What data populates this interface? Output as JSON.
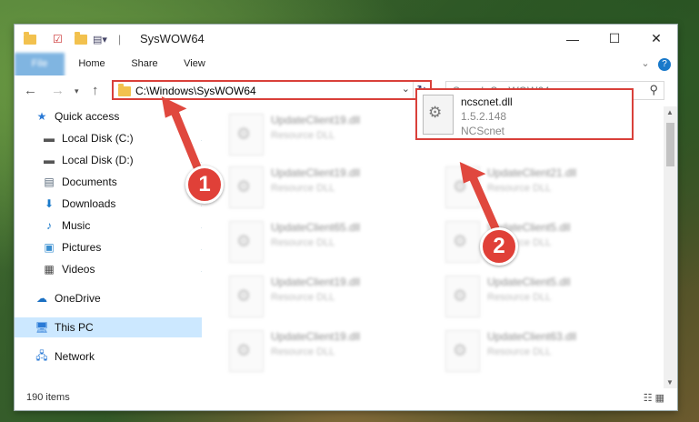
{
  "window": {
    "title": "SysWOW64",
    "controls": {
      "minimize": "—",
      "maximize": "☐",
      "close": "✕"
    }
  },
  "ribbon": {
    "tabs": [
      "File",
      "Home",
      "Share",
      "View"
    ]
  },
  "address": {
    "path": "C:\\Windows\\SysWOW64",
    "search_placeholder": "Search SysWOW64"
  },
  "sidebar": {
    "items": [
      {
        "label": "Quick access",
        "icon": "star-icon",
        "pinned": false
      },
      {
        "label": "Local Disk (C:)",
        "icon": "drive-icon",
        "pinned": true
      },
      {
        "label": "Local Disk (D:)",
        "icon": "drive-icon",
        "pinned": true
      },
      {
        "label": "Documents",
        "icon": "documents-icon",
        "pinned": true
      },
      {
        "label": "Downloads",
        "icon": "download-icon",
        "pinned": true
      },
      {
        "label": "Music",
        "icon": "music-icon",
        "pinned": true
      },
      {
        "label": "Pictures",
        "icon": "pictures-icon",
        "pinned": true
      },
      {
        "label": "Videos",
        "icon": "videos-icon",
        "pinned": true
      },
      {
        "label": "OneDrive",
        "icon": "cloud-icon",
        "pinned": false
      },
      {
        "label": "This PC",
        "icon": "computer-icon",
        "pinned": false,
        "selected": true
      },
      {
        "label": "Network",
        "icon": "network-icon",
        "pinned": false
      }
    ]
  },
  "files": {
    "left_column": [
      {
        "name": "UpdateClient19.dll",
        "type": "Resource DLL"
      },
      {
        "name": "UpdateClient19.dll",
        "type": "Resource DLL"
      },
      {
        "name": "UpdateClient65.dll",
        "type": "Resource DLL"
      },
      {
        "name": "UpdateClient19.dll",
        "type": "Resource DLL"
      },
      {
        "name": "UpdateClient19.dll",
        "type": "Resource DLL"
      }
    ],
    "right_column": [
      {
        "name": "UpdateClient21.dll",
        "type": "Resource DLL"
      },
      {
        "name": "UpdateClient5.dll",
        "type": "Resource DLL"
      },
      {
        "name": "UpdateClient5.dll",
        "type": "Resource DLL"
      },
      {
        "name": "UpdateClient63.dll",
        "type": "Resource DLL"
      }
    ],
    "featured": {
      "name": "ncscnet.dll",
      "version": "1.5.2.148",
      "company": "NCScnet"
    }
  },
  "status": {
    "item_count": "190 items"
  },
  "callouts": {
    "first": "1",
    "second": "2"
  },
  "colors": {
    "accent": "#1979ca",
    "highlight": "#d9403a",
    "selected": "#cce8ff"
  }
}
